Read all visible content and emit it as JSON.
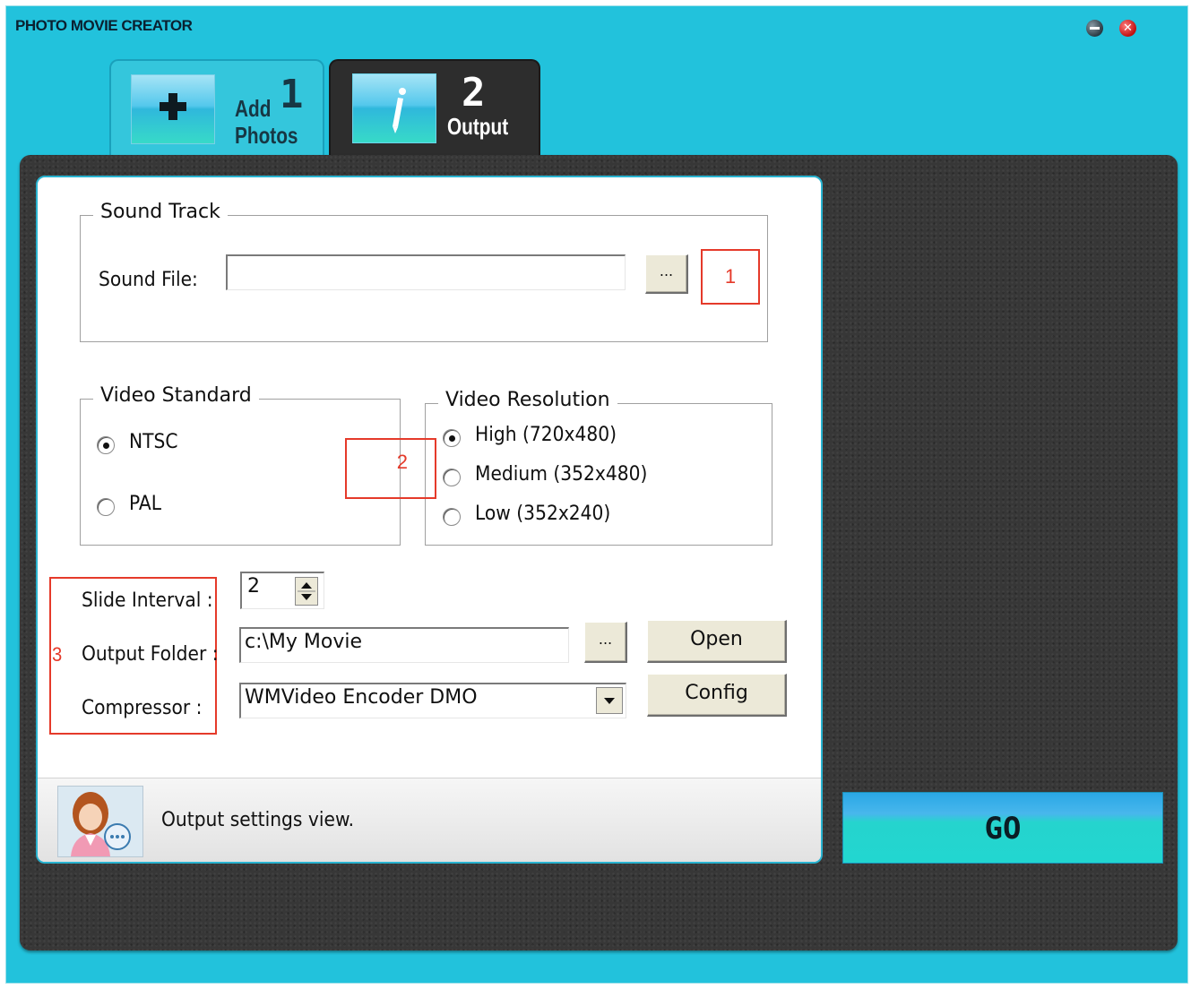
{
  "window": {
    "title": "PHOTO MOVIE CREATOR",
    "minimize_icon": "minimize-icon",
    "close_icon": "close-icon"
  },
  "tabs": [
    {
      "label_line1": "Add",
      "label_line2": "Photos",
      "number": "1",
      "icon": "plus-icon",
      "selected": false
    },
    {
      "label": "Output",
      "number": "2",
      "icon": "pen-icon",
      "selected": true
    }
  ],
  "sound_track": {
    "legend": "Sound Track",
    "sound_file_label": "Sound File:",
    "sound_file_value": "",
    "browse_label": "..."
  },
  "video_standard": {
    "legend": "Video Standard",
    "options": [
      {
        "label": "NTSC",
        "checked": true
      },
      {
        "label": "PAL",
        "checked": false
      }
    ]
  },
  "video_resolution": {
    "legend": "Video Resolution",
    "options": [
      {
        "label": "High (720x480)",
        "checked": true
      },
      {
        "label": "Medium (352x480)",
        "checked": false
      },
      {
        "label": "Low (352x240)",
        "checked": false
      }
    ]
  },
  "settings": {
    "slide_interval_label": "Slide Interval :",
    "slide_interval_value": "2",
    "output_folder_label": "Output Folder :",
    "output_folder_value": "c:\\My Movie",
    "output_browse_label": "...",
    "open_label": "Open",
    "compressor_label": "Compressor :",
    "compressor_value": "WMVideo Encoder DMO",
    "config_label": "Config"
  },
  "markers": {
    "m1": "1",
    "m2": "2",
    "m3": "3"
  },
  "status": {
    "text": "Output settings view.",
    "avatar_icon": "assistant-avatar-icon"
  },
  "go_label": "GO",
  "colors": {
    "accent": "#22c2dc",
    "panel": "#373737",
    "marker": "#e53a2a"
  }
}
